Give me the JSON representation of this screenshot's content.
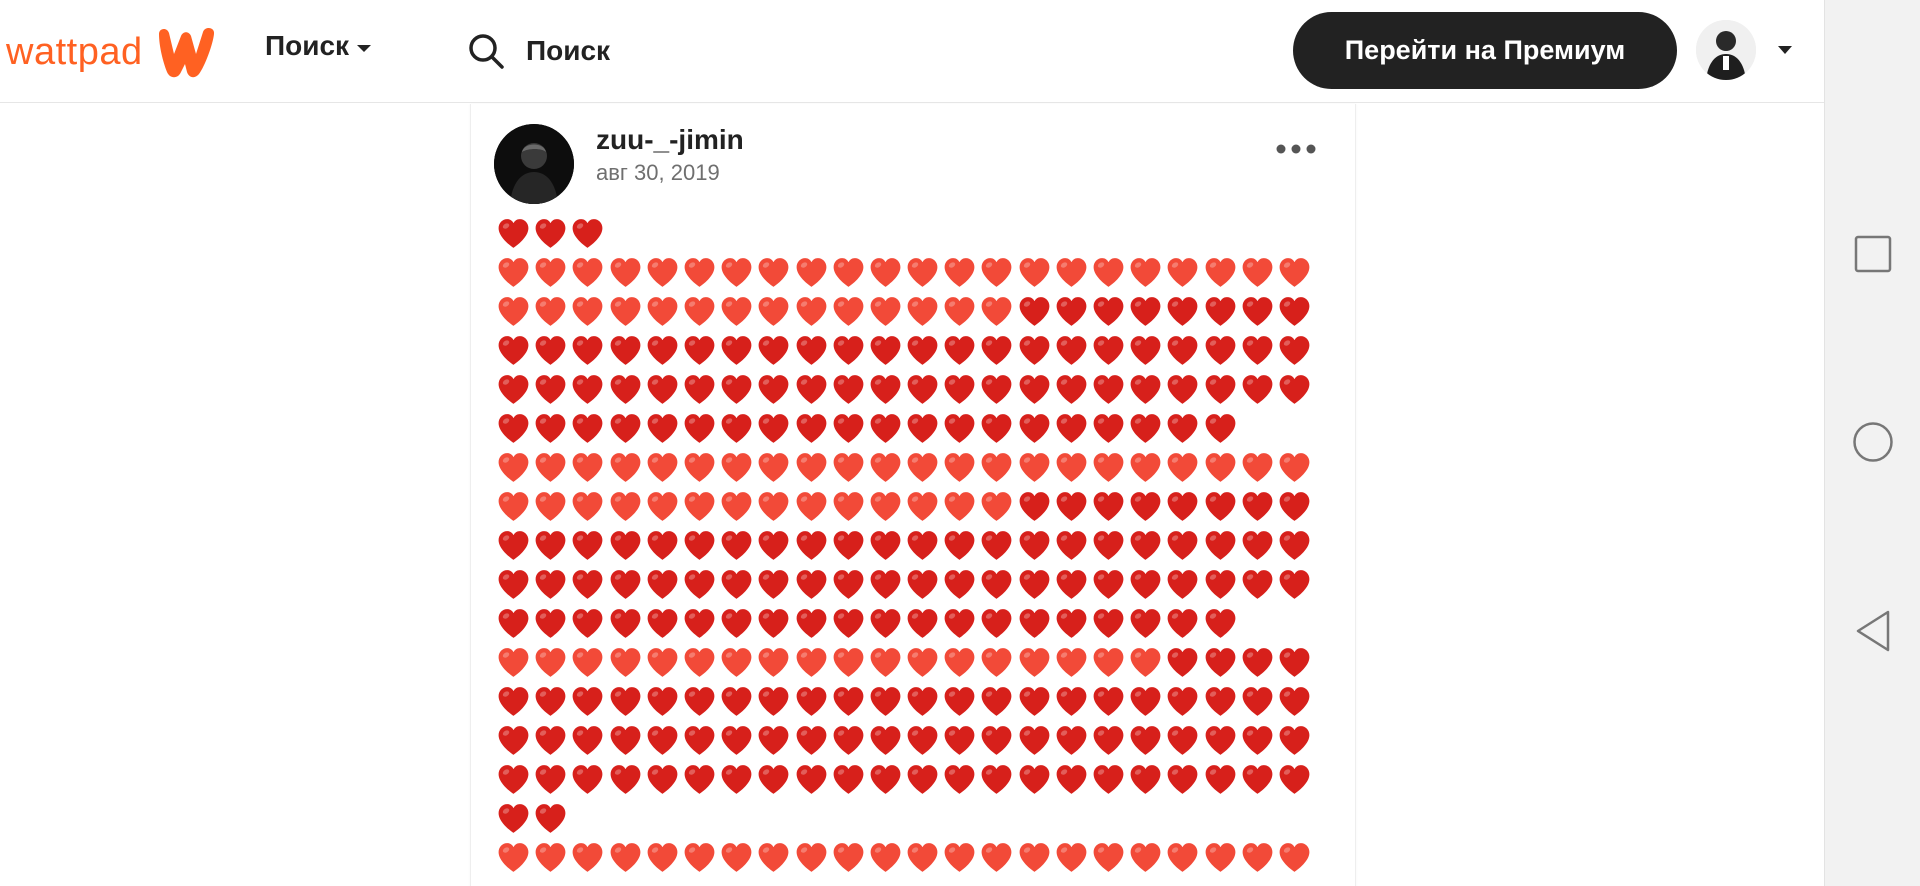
{
  "header": {
    "logo_text": "wattpad",
    "discover_label": "Поиск",
    "search_placeholder": "Поиск",
    "premium_button_label": "Перейти на Премиум"
  },
  "post": {
    "username": "zuu-_-jimin",
    "date": "авг 30, 2019",
    "more_icon": "more-horizontal-icon",
    "heart_rows": [
      "RRR",
      "LLLLLLLLLLLLLLLLLLLLLL",
      "LLLLLLLLLLLLLLRRRRRRRR",
      "RRRRRRRRRRRRRRRRRRRRRR",
      "RRRRRRRRRRRRRRRRRRRRRR",
      "RRRRRRRRRRRRRRRRRRRR",
      "LLLLLLLLLLLLLLLLLLLLLL",
      "LLLLLLLLLLLLLLRRRRRRRR",
      "RRRRRRRRRRRRRRRRRRRRRR",
      "RRRRRRRRRRRRRRRRRRRRRR",
      "RRRRRRRRRRRRRRRRRRRR",
      "LLLLLLLLLLLLLLLLLLRRRR",
      "RRRRRRRRRRRRRRRRRRRRRR",
      "RRRRRRRRRRRRRRRRRRRRRR",
      "RRRRRRRRRRRRRRRRRRRRRR",
      "RR",
      "LLLLLLLLLLLLLLLLLLLLLL"
    ]
  },
  "colors": {
    "brand_orange": "#ff6122",
    "heart_light": "#f24a38",
    "heart_dark": "#d7201b",
    "premium_bg": "#222222"
  },
  "navbar": {
    "icons": [
      "recent-apps-icon",
      "home-icon",
      "back-icon"
    ]
  }
}
